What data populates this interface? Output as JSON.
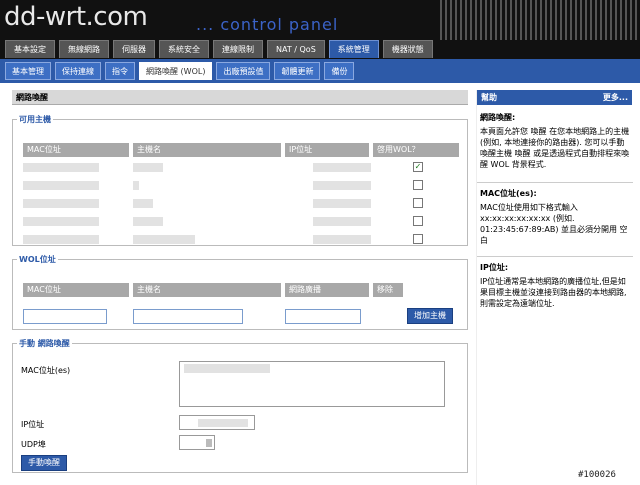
{
  "header": {
    "logo": "dd-wrt.com",
    "subtitle": "... control panel"
  },
  "tabs_top": [
    "基本設定",
    "無線網路",
    "伺服器",
    "系統安全",
    "連線限制",
    "NAT / QoS",
    "系統管理",
    "機器狀態"
  ],
  "tabs_sub": [
    "基本管理",
    "保持連線",
    "指令",
    "網路喚醒 (WOL)",
    "出廠預設值",
    "韌體更新",
    "備份"
  ],
  "page": {
    "title": "網路喚醒"
  },
  "hosts": {
    "legend": "可用主機",
    "headers": [
      "MAC位址",
      "主機名",
      "IP位址",
      "啓用WOL？"
    ],
    "rows": [
      {
        "wol": true
      },
      {
        "wol": false
      },
      {
        "wol": false
      },
      {
        "wol": false
      },
      {
        "wol": false
      }
    ]
  },
  "wol_addresses": {
    "legend": "WOL位址",
    "headers": [
      "MAC位址",
      "主機名",
      "網路廣播",
      "移除"
    ],
    "add_button": "增加主機"
  },
  "manual": {
    "legend": "手動 網路喚醒",
    "mac_label": "MAC位址(es)",
    "ip_label": "IP位址",
    "port_label": "UDP埠",
    "wake_button": "手動喚醒"
  },
  "help": {
    "title": "幫助",
    "more": "更多...",
    "wol_heading": "網路喚醒:",
    "wol_text": "本頁面允許您 喚醒 在您本地網路上的主機 (例如, 本地連接你的路由器). 您可以手動喚醒主機 喚醒 或是透過程式自動排程來喚醒 WOL 背景程式.",
    "mac_heading": "MAC位址(es):",
    "mac_text": "MAC位址使用如下格式輸入 xx:xx:xx:xx:xx:xx (例如. 01:23:45:67:89:AB) 並且必須分開用 空白",
    "ip_heading": "IP位址:",
    "ip_text": "IP位址通常是本地網路的廣播位址,但是如果目標主機並沒連接到路由器的本地網路,則需設定為遠端位址."
  },
  "watermark": "#100026"
}
